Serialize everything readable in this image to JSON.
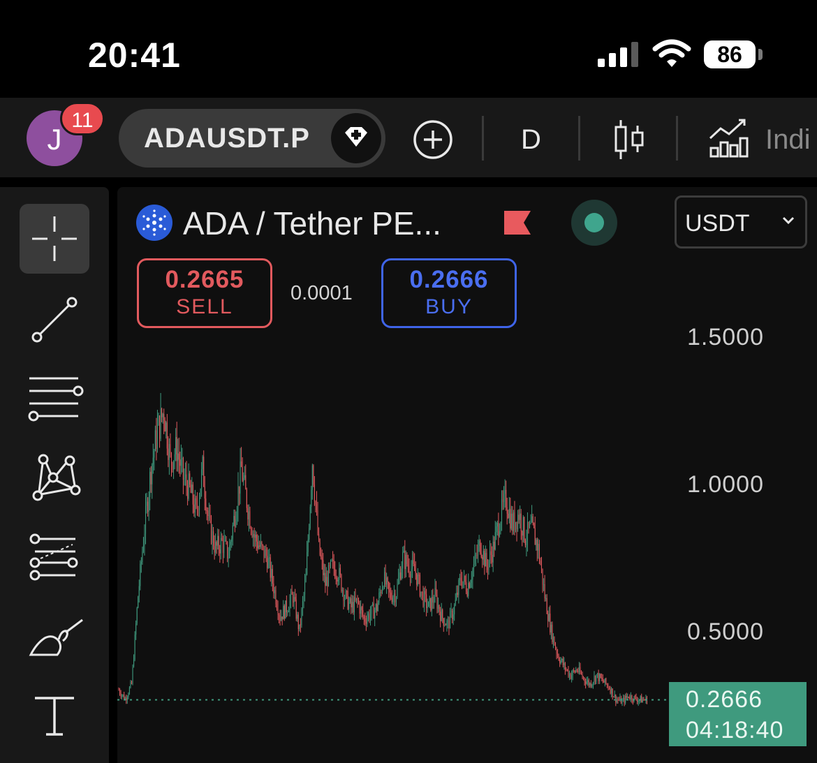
{
  "status_bar": {
    "time": "20:41",
    "battery": "86"
  },
  "toolbar": {
    "notification_count": "11",
    "avatar_initial": "J",
    "symbol": "ADAUSDT.P",
    "interval": "D",
    "indicators_label": "Indi"
  },
  "chart_header": {
    "title": "ADA / Tether PE...",
    "currency": "USDT"
  },
  "trade": {
    "sell_price": "0.2665",
    "sell_label": "SELL",
    "spread": "0.0001",
    "buy_price": "0.2666",
    "buy_label": "BUY"
  },
  "colors": {
    "up": "#3f9a7e",
    "down": "#e25a5e",
    "buy": "#3f64e8",
    "sell": "#e25a5e",
    "background": "#0f0f0f"
  },
  "chart_data": {
    "type": "candlestick",
    "y_axis": {
      "ticks": [
        "1.5000",
        "1.0000",
        "0.5000"
      ],
      "ylim": [
        0.15,
        2.0
      ]
    },
    "current_price": "0.2666",
    "countdown": "04:18:40",
    "closes": [
      0.3,
      0.27,
      0.32,
      0.62,
      0.85,
      1.05,
      1.18,
      1.25,
      1.08,
      1.12,
      1.02,
      0.98,
      0.9,
      1.05,
      0.86,
      0.78,
      0.8,
      0.76,
      0.9,
      1.05,
      0.92,
      0.82,
      0.78,
      0.75,
      0.65,
      0.55,
      0.58,
      0.62,
      0.5,
      0.68,
      1.08,
      0.78,
      0.66,
      0.72,
      0.7,
      0.62,
      0.58,
      0.6,
      0.54,
      0.56,
      0.58,
      0.68,
      0.62,
      0.63,
      0.75,
      0.72,
      0.7,
      0.62,
      0.58,
      0.62,
      0.55,
      0.52,
      0.58,
      0.68,
      0.65,
      0.72,
      0.8,
      0.72,
      0.78,
      0.88,
      0.95,
      0.86,
      0.9,
      0.82,
      0.85,
      0.78,
      0.62,
      0.5,
      0.42,
      0.38,
      0.35,
      0.37,
      0.34,
      0.32,
      0.35,
      0.33,
      0.31,
      0.27,
      0.26,
      0.28,
      0.27,
      0.2666
    ]
  },
  "tools": [
    {
      "name": "crosshair"
    },
    {
      "name": "trend-line"
    },
    {
      "name": "horizontal-lines"
    },
    {
      "name": "pattern"
    },
    {
      "name": "fib-retracement"
    },
    {
      "name": "brush"
    },
    {
      "name": "text"
    }
  ]
}
